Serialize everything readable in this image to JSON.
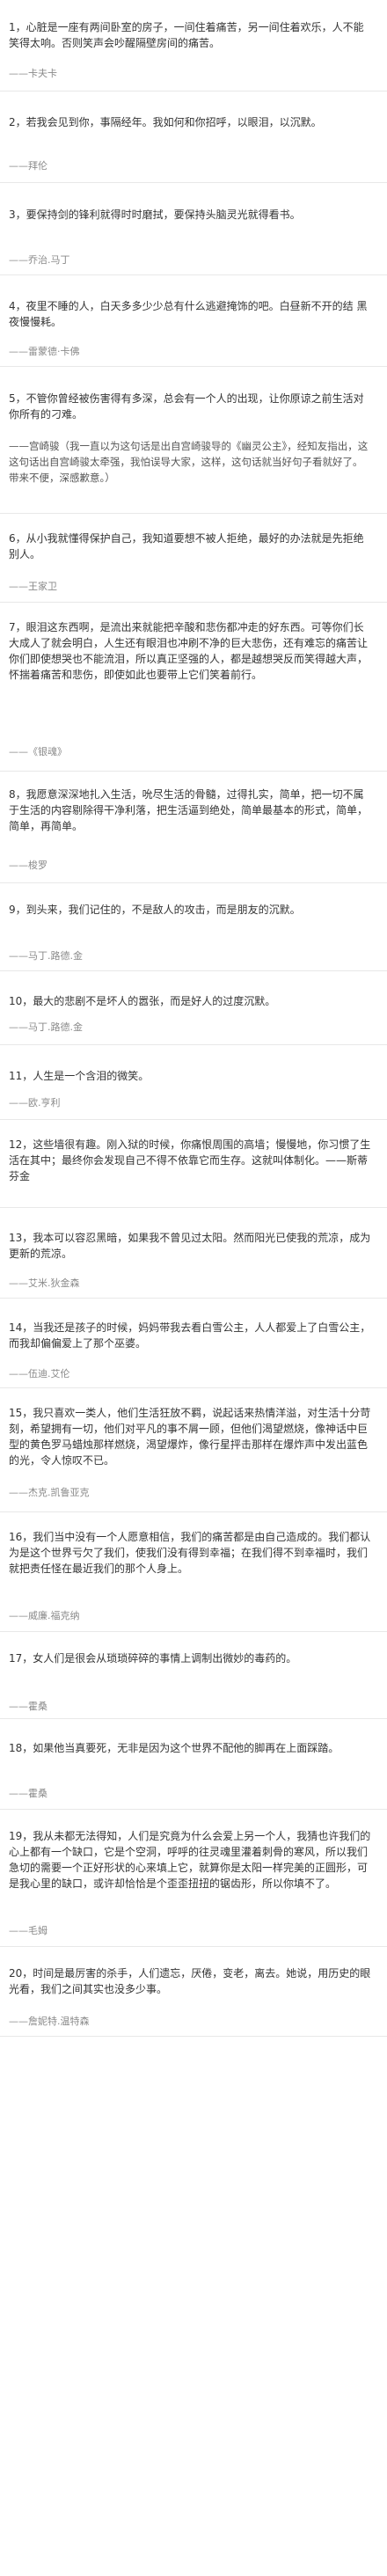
{
  "entries": [
    {
      "text": "1，心脏是一座有两间卧室的房子，一间住着痛苦，另一间住着欢乐，人不能笑得太响。否则笑声会吵醒隔壁房间的痛苦。",
      "author": "——卡夫卡"
    },
    {
      "text": "2，若我会见到你，事隔经年。我如何和你招呼，以眼泪，以沉默。",
      "author": "——拜伦"
    },
    {
      "text": "3，要保持剑的锋利就得时时磨拭，要保持头脑灵光就得看书。",
      "author": "——乔治.马丁"
    },
    {
      "text": "4，夜里不睡的人，白天多多少少总有什么逃避掩饰的吧。白昼新不开的结 黑夜慢慢耗。",
      "author": "——雷蒙德·卡佛"
    },
    {
      "text": "5，不管你曾经被伤害得有多深，总会有一个人的出现，让你原谅之前生活对你所有的刁难。",
      "author": "——宫崎骏（我一直以为这句话是出自宫崎骏导的《幽灵公主》，经知友指出，这这句话出自宫崎骏太牵强，我怕误导大家，这样，这句话就当好句子看就好了。带来不便，深感歉意。）"
    },
    {
      "text": "6，从小我就懂得保护自己，我知道要想不被人拒绝，最好的办法就是先拒绝别人。",
      "author": "——王家卫"
    },
    {
      "text": "7，眼泪这东西啊，是流出来就能把辛酸和悲伤都冲走的好东西。可等你们长大成人了就会明白，人生还有眼泪也冲刷不净的巨大悲伤，还有难忘的痛苦让你们即使想哭也不能流泪，所以真正坚强的人，都是越想哭反而笑得越大声，怀揣着痛苦和悲伤，即使如此也要带上它们笑着前行。",
      "author": "——《银魂》"
    },
    {
      "text": "8，我愿意深深地扎入生活，吮尽生活的骨髓，过得扎实，简单，把一切不属于生活的内容剔除得干净利落，把生活逼到绝处，简单最基本的形式，简单，简单，再简单。",
      "author": "——梭罗"
    },
    {
      "text": "9，到头来，我们记住的，不是敌人的攻击，而是朋友的沉默。",
      "author": "——马丁.路德.金"
    },
    {
      "text": "10，最大的悲剧不是坏人的嚣张，而是好人的过度沉默。",
      "author": "——马丁.路德.金"
    },
    {
      "text": "11，人生是一个含泪的微笑。",
      "author": "——欧.亨利"
    },
    {
      "text": "12，这些墙很有趣。刚入狱的时候，你痛恨周围的高墙；慢慢地，你习惯了生活在其中；最终你会发现自己不得不依靠它而生存。这就叫体制化。——斯蒂芬金",
      "author": ""
    },
    {
      "text": "13，我本可以容忍黑暗，如果我不曾见过太阳。然而阳光已使我的荒凉，成为更新的荒凉。",
      "author": "——艾米.狄金森"
    },
    {
      "text": "14，当我还是孩子的时候，妈妈带我去看白雪公主，人人都爱上了白雪公主，而我却偏偏爱上了那个巫婆。",
      "author": "——伍迪.艾伦"
    },
    {
      "text": "15，我只喜欢一类人，他们生活狂放不羁，说起话来热情洋溢，对生活十分苛刻，希望拥有一切，他们对平凡的事不屑一顾，但他们渴望燃烧，像神话中巨型的黄色罗马蜡烛那样燃烧，渴望爆炸，像行星抨击那样在爆炸声中发出蓝色的光，令人惊叹不已。",
      "author": "——杰克.凯鲁亚克"
    },
    {
      "text": "16，我们当中没有一个人愿意相信，我们的痛苦都是由自己造成的。我们都认为是这个世界亏欠了我们，使我们没有得到幸福；在我们得不到幸福时，我们就把责任怪在最近我们的那个人身上。",
      "author": "——威廉.福克纳"
    },
    {
      "text": "17，女人们是很会从琐琐碎碎的事情上调制出微妙的毒药的。",
      "author": "——霍桑"
    },
    {
      "text": "18，如果他当真要死，无非是因为这个世界不配他的脚再在上面踩踏。",
      "author": "——霍桑"
    },
    {
      "text": "19，我从未都无法得知，人们是究竟为什么会爱上另一个人，我猜也许我们的心上都有一个缺口，它是个空洞，呼呼的往灵魂里灌着刺骨的寒风，所以我们急切的需要一个正好形状的心来填上它，就算你是太阳一样完美的正圆形，可是我心里的缺口，或许却恰恰是个歪歪扭扭的锯齿形，所以你填不了。",
      "author": "——毛姆"
    },
    {
      "text": "20，时间是最厉害的杀手，人们遗忘，厌倦，变老，离去。她说，用历史的眼光看，我们之间其实也没多少事。",
      "author": "——詹妮特.温特森"
    }
  ]
}
